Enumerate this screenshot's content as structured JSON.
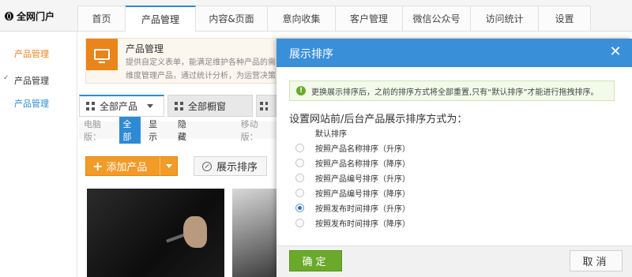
{
  "brand": {
    "title": "全网门户",
    "icon": "globe-icon"
  },
  "nav": {
    "tabs": [
      {
        "label": "首页"
      },
      {
        "label": "产品管理",
        "active": true
      },
      {
        "label": "内容&页面"
      },
      {
        "label": "意向收集"
      },
      {
        "label": "客户管理"
      },
      {
        "label": "微信公众号"
      },
      {
        "label": "访问统计"
      },
      {
        "label": "设置"
      }
    ]
  },
  "sidebar": {
    "category": "产品管理",
    "items": [
      {
        "label": "产品管理"
      },
      {
        "label": "产品管理"
      }
    ]
  },
  "intro": {
    "title": "产品管理",
    "desc_line1": "提供自定义表单，能满足维护各种产品的需",
    "desc_line2": "维度管理产品，通过统计分析，为运营决策"
  },
  "subtabs": {
    "all_products": "全部产品",
    "all_windows": "全部橱窗"
  },
  "filter": {
    "pc_label": "电脑版：",
    "all": "全部",
    "show": "显示",
    "hide": "隐藏",
    "mobile_label": "移动版："
  },
  "toolbar": {
    "add_product": "添加产品",
    "show_sort": "展示排序"
  },
  "modal": {
    "title": "展示排序",
    "close": "✕",
    "notice": "更换展示排序后，之前的排序方式将全部重置,只有“默认排序”才能进行拖拽排序。",
    "prompt": "设置网站前/后台产品展示排序方式为：",
    "options": [
      {
        "label": "默认排序",
        "selected": false,
        "radio": false
      },
      {
        "label": "按照产品名称排序（升序）",
        "selected": false,
        "radio": true
      },
      {
        "label": "按照产品名称排序（降序）",
        "selected": false,
        "radio": true
      },
      {
        "label": "按照产品编号排序（升序）",
        "selected": false,
        "radio": true
      },
      {
        "label": "按照产品编号排序（降序）",
        "selected": false,
        "radio": true
      },
      {
        "label": "按照发布时间排序（升序）",
        "selected": true,
        "radio": true
      },
      {
        "label": "按照发布时间排序（降序）",
        "selected": false,
        "radio": true
      }
    ],
    "ok": "确定",
    "cancel": "取消"
  },
  "colors": {
    "accent_blue": "#3a8fd9",
    "orange": "#e9851a",
    "confirm_green": "#6aa92a"
  }
}
